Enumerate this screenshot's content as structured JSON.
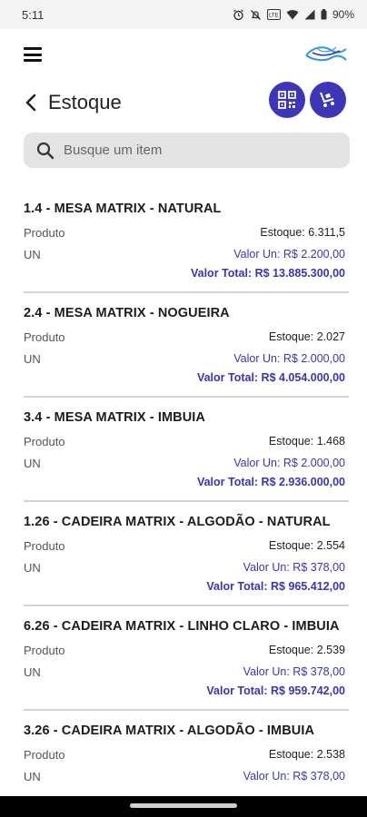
{
  "status_bar": {
    "time": "5:11",
    "battery": "90%",
    "icons": [
      "alarm-icon",
      "mute-icon",
      "volte-icon",
      "wifi-icon",
      "signal-icon",
      "battery-icon"
    ]
  },
  "header": {
    "title": "Estoque",
    "menu_icon": "hamburger-icon",
    "logo_icon": "brand-logo",
    "back_icon": "chevron-left-icon",
    "qr_icon": "qr-code-icon",
    "cart_icon": "cart-icon"
  },
  "search": {
    "placeholder": "Busque um item",
    "value": ""
  },
  "colors": {
    "accent": "#3d36b8",
    "price_text": "#3a35b3",
    "search_bg": "#e3e3e3",
    "divider": "#d4d4d4"
  },
  "items": [
    {
      "title": "1.4 - MESA MATRIX - NATURAL",
      "type": "Produto",
      "unit": "UN",
      "stock": "Estoque: 6.311,5",
      "price": "Valor Un: R$ 2.200,00",
      "total": "Valor Total: R$ 13.885.300,00"
    },
    {
      "title": "2.4 - MESA MATRIX - NOGUEIRA",
      "type": "Produto",
      "unit": "UN",
      "stock": "Estoque: 2.027",
      "price": "Valor Un: R$ 2.000,00",
      "total": "Valor Total: R$ 4.054.000,00"
    },
    {
      "title": "3.4 - MESA MATRIX - IMBUIA",
      "type": "Produto",
      "unit": "UN",
      "stock": "Estoque: 1.468",
      "price": "Valor Un: R$ 2.000,00",
      "total": "Valor Total: R$ 2.936.000,00"
    },
    {
      "title": "1.26 - CADEIRA MATRIX - ALGODÃO - NATURAL",
      "type": "Produto",
      "unit": "UN",
      "stock": "Estoque: 2.554",
      "price": "Valor Un: R$ 378,00",
      "total": "Valor Total: R$ 965.412,00"
    },
    {
      "title": "6.26 - CADEIRA MATRIX - LINHO CLARO - IMBUIA",
      "type": "Produto",
      "unit": "UN",
      "stock": "Estoque: 2.539",
      "price": "Valor Un: R$ 378,00",
      "total": "Valor Total: R$ 959.742,00"
    },
    {
      "title": "3.26 - CADEIRA MATRIX - ALGODÃO - IMBUIA",
      "type": "Produto",
      "unit": "UN",
      "stock": "Estoque: 2.538",
      "price": "Valor Un: R$ 378,00",
      "total": ""
    }
  ]
}
